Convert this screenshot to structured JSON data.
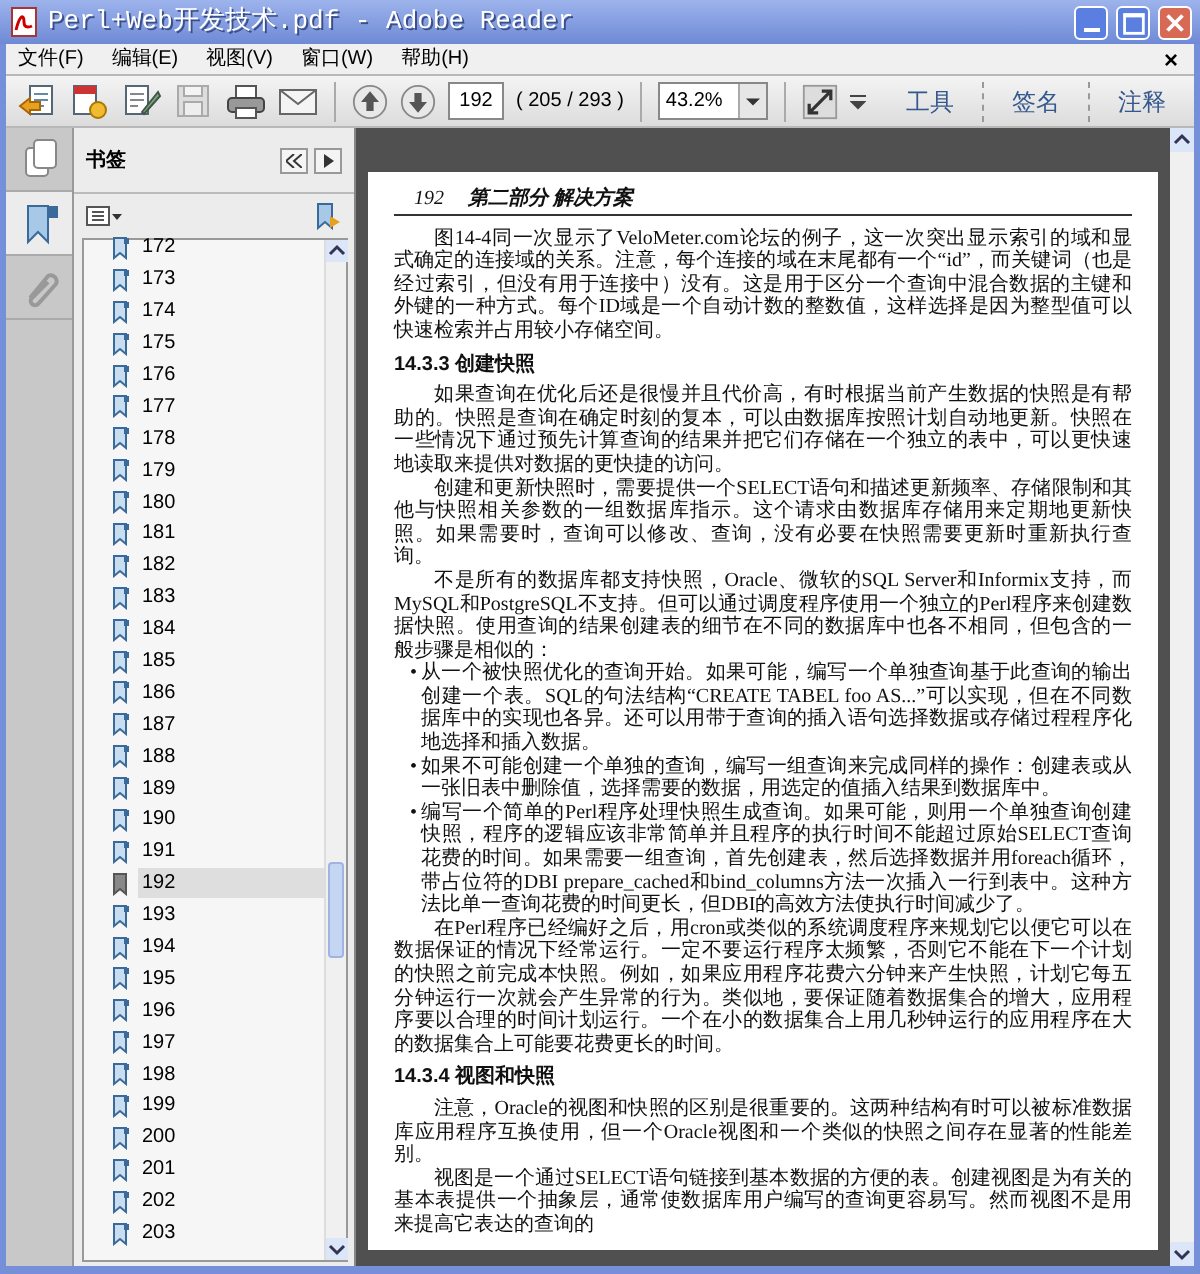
{
  "window": {
    "title": "Perl+Web开发技术.pdf - Adobe Reader"
  },
  "menu": {
    "items": [
      "文件(F)",
      "编辑(E)",
      "视图(V)",
      "窗口(W)",
      "帮助(H)"
    ],
    "close": "×"
  },
  "toolbar": {
    "page_input": "192",
    "page_count": "( 205 / 293 )",
    "zoom": "43.2%",
    "tasks": [
      "工具",
      "签名",
      "注释"
    ]
  },
  "sidebar": {
    "tabs": [
      {
        "kind": "pages",
        "selected": false
      },
      {
        "kind": "bookmarks",
        "selected": true
      },
      {
        "kind": "attachments",
        "selected": false
      }
    ],
    "panel_title": "书签",
    "bookmarks": [
      {
        "label": "172",
        "selected": false
      },
      {
        "label": "173",
        "selected": false
      },
      {
        "label": "174",
        "selected": false
      },
      {
        "label": "175",
        "selected": false
      },
      {
        "label": "176",
        "selected": false
      },
      {
        "label": "177",
        "selected": false
      },
      {
        "label": "178",
        "selected": false
      },
      {
        "label": "179",
        "selected": false
      },
      {
        "label": "180",
        "selected": false
      },
      {
        "label": "181",
        "selected": false
      },
      {
        "label": "182",
        "selected": false
      },
      {
        "label": "183",
        "selected": false
      },
      {
        "label": "184",
        "selected": false
      },
      {
        "label": "185",
        "selected": false
      },
      {
        "label": "186",
        "selected": false
      },
      {
        "label": "187",
        "selected": false
      },
      {
        "label": "188",
        "selected": false
      },
      {
        "label": "189",
        "selected": false
      },
      {
        "label": "190",
        "selected": false
      },
      {
        "label": "191",
        "selected": false
      },
      {
        "label": "192",
        "selected": true
      },
      {
        "label": "193",
        "selected": false
      },
      {
        "label": "194",
        "selected": false
      },
      {
        "label": "195",
        "selected": false
      },
      {
        "label": "196",
        "selected": false
      },
      {
        "label": "197",
        "selected": false
      },
      {
        "label": "198",
        "selected": false
      },
      {
        "label": "199",
        "selected": false
      },
      {
        "label": "200",
        "selected": false
      },
      {
        "label": "201",
        "selected": false
      },
      {
        "label": "202",
        "selected": false
      },
      {
        "label": "203",
        "selected": false
      }
    ]
  },
  "document": {
    "running_head": {
      "page": "192",
      "title": "第二部分 解决方案"
    },
    "blocks": [
      {
        "kind": "paragraph",
        "text": "图14-4同一次显示了VeloMeter.com论坛的例子，这一次突出显示索引的域和显式确定的连接域的关系。注意，每个连接的域在末尾都有一个“id”，而关键词（也是经过索引，但没有用于连接中）没有。这是用于区分一个查询中混合数据的主键和外键的一种方式。每个ID域是一个自动计数的整数值，这样选择是因为整型值可以快速检索并占用较小存储空间。"
      },
      {
        "kind": "heading",
        "text": "14.3.3 创建快照"
      },
      {
        "kind": "paragraph",
        "text": "如果查询在优化后还是很慢并且代价高，有时根据当前产生数据的快照是有帮助的。快照是查询在确定时刻的复本，可以由数据库按照计划自动地更新。快照在一些情况下通过预先计算查询的结果并把它们存储在一个独立的表中，可以更快速地读取来提供对数据的更快捷的访问。"
      },
      {
        "kind": "paragraph",
        "text": "创建和更新快照时，需要提供一个SELECT语句和描述更新频率、存储限制和其他与快照相关参数的一组数据库指示。这个请求由数据库存储用来定期地更新快照。如果需要时，查询可以修改、查询，没有必要在快照需要更新时重新执行查询。"
      },
      {
        "kind": "paragraph",
        "text": "不是所有的数据库都支持快照，Oracle、微软的SQL Server和Informix支持，而MySQL和PostgreSQL不支持。但可以通过调度程序使用一个独立的Perl程序来创建数据快照。使用查询的结果创建表的细节在不同的数据库中也各不相同，但包含的一般步骤是相似的："
      },
      {
        "kind": "bullet",
        "marker": "•",
        "text": "从一个被快照优化的查询开始。如果可能，编写一个单独查询基于此查询的输出创建一个表。SQL的句法结构“CREATE TABEL foo AS...”可以实现，但在不同数据库中的实现也各异。还可以用带于查询的插入语句选择数据或存储过程程序化地选择和插入数据。"
      },
      {
        "kind": "bullet",
        "marker": "•",
        "text": "如果不可能创建一个单独的查询，编写一组查询来完成同样的操作：创建表或从一张旧表中删除值，选择需要的数据，用选定的值插入结果到数据库中。"
      },
      {
        "kind": "bullet",
        "marker": "•",
        "text": "编写一个简单的Perl程序处理快照生成查询。如果可能，则用一个单独查询创建快照，程序的逻辑应该非常简单并且程序的执行时间不能超过原始SELECT查询花费的时间。如果需要一组查询，首先创建表，然后选择数据并用foreach循环，带占位符的DBI prepare_cached和bind_columns方法一次插入一行到表中。这种方法比单一查询花费的时间更长，但DBI的高效方法使执行时间减少了。"
      },
      {
        "kind": "paragraph",
        "text": "在Perl程序已经编好之后，用cron或类似的系统调度程序来规划它以便它可以在数据保证的情况下经常运行。一定不要运行程序太频繁，否则它不能在下一个计划的快照之前完成本快照。例如，如果应用程序花费六分钟来产生快照，计划它每五分钟运行一次就会产生异常的行为。类似地，要保证随着数据集合的增大，应用程序要以合理的时间计划运行。一个在小的数据集合上用几秒钟运行的应用程序在大的数据集合上可能要花费更长的时间。"
      },
      {
        "kind": "heading",
        "text": "14.3.4 视图和快照"
      },
      {
        "kind": "paragraph",
        "text": "注意，Oracle的视图和快照的区别是很重要的。这两种结构有时可以被标准数据库应用程序互换使用，但一个Oracle视图和一个类似的快照之间存在显著的性能差别。"
      },
      {
        "kind": "paragraph",
        "text": "视图是一个通过SELECT语句链接到基本数据的方便的表。创建视图是为有关的基本表提供一个抽象层，通常使数据库用户编写的查询更容易写。然而视图不是用来提高它表达的查询的"
      }
    ]
  }
}
